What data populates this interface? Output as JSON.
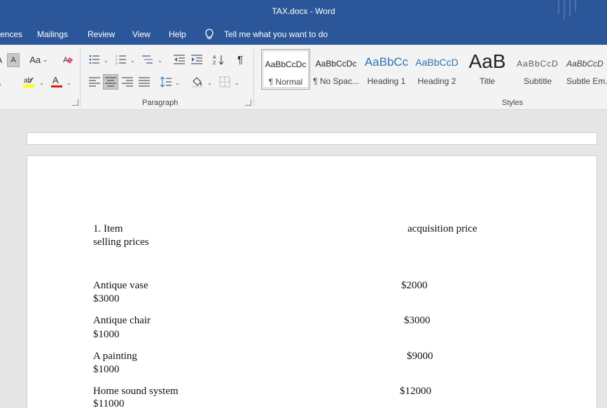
{
  "window": {
    "title": "TAX.docx  -  Word"
  },
  "menu": {
    "tabs": [
      "ences",
      "Mailings",
      "Review",
      "View",
      "Help"
    ],
    "tell_me": "Tell me what you want to do"
  },
  "ribbon": {
    "font_group": {
      "change_case": "Aa"
    },
    "paragraph_label": "Paragraph",
    "styles_label": "Styles",
    "styles": [
      {
        "preview": "AaBbCcDc",
        "label": "¶ Normal"
      },
      {
        "preview": "AaBbCcDc",
        "label": "¶ No Spac..."
      },
      {
        "preview": "AaBbCc",
        "label": "Heading 1"
      },
      {
        "preview": "AaBbCcD",
        "label": "Heading 2"
      },
      {
        "preview": "AaB",
        "label": "Title"
      },
      {
        "preview": "AaBbCcD",
        "label": "Subtitle"
      },
      {
        "preview": "AaBbCcD",
        "label": "Subtle Em..."
      }
    ]
  },
  "document": {
    "header": {
      "item": "1. Item",
      "acquisition": "acquisition price",
      "selling": "selling prices"
    },
    "rows": [
      {
        "item": "Antique vase",
        "acquisition": "$2000",
        "selling": "$3000"
      },
      {
        "item": "Antique chair",
        "acquisition": "$3000",
        "selling": "$1000"
      },
      {
        "item": "A painting",
        "acquisition": "$9000",
        "selling": "$1000"
      },
      {
        "item": "Home sound system",
        "acquisition": "$12000",
        "selling": "$11000"
      }
    ]
  },
  "colors": {
    "accent": "#2b579a",
    "ribbon": "#f3f3f3",
    "canvas": "#e6e6e6"
  }
}
